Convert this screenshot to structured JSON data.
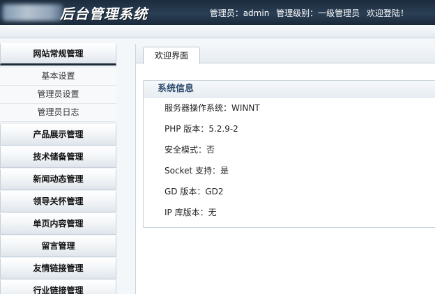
{
  "header": {
    "system_title": "后台管理系统",
    "admin_label": "管理员：admin",
    "level_label": "管理级别：一级管理员",
    "welcome": "欢迎登陆！"
  },
  "sidebar": {
    "groups": [
      {
        "label": "网站常规管理",
        "items": [
          "基本设置",
          "管理员设置",
          "管理员日志"
        ]
      },
      {
        "label": "产品展示管理"
      },
      {
        "label": "技术储备管理"
      },
      {
        "label": "新闻动态管理"
      },
      {
        "label": "领导关怀管理"
      },
      {
        "label": "单页内容管理"
      },
      {
        "label": "留言管理"
      },
      {
        "label": "友情链接管理"
      },
      {
        "label": "行业链接管理"
      }
    ]
  },
  "main": {
    "tab_label": "欢迎界面",
    "panel_title": "系统信息",
    "info": [
      {
        "label": "服务器操作系统：",
        "value": "WINNT"
      },
      {
        "label": "PHP 版本：",
        "value": "5.2.9-2"
      },
      {
        "label": "安全模式：",
        "value": "否"
      },
      {
        "label": "Socket 支持：",
        "value": "是"
      },
      {
        "label": "GD 版本：",
        "value": "GD2"
      },
      {
        "label": "IP 库版本：",
        "value": "无"
      }
    ]
  },
  "colors": {
    "header_bg": "#1c2c3e",
    "panel_title": "#2b4a6b"
  }
}
